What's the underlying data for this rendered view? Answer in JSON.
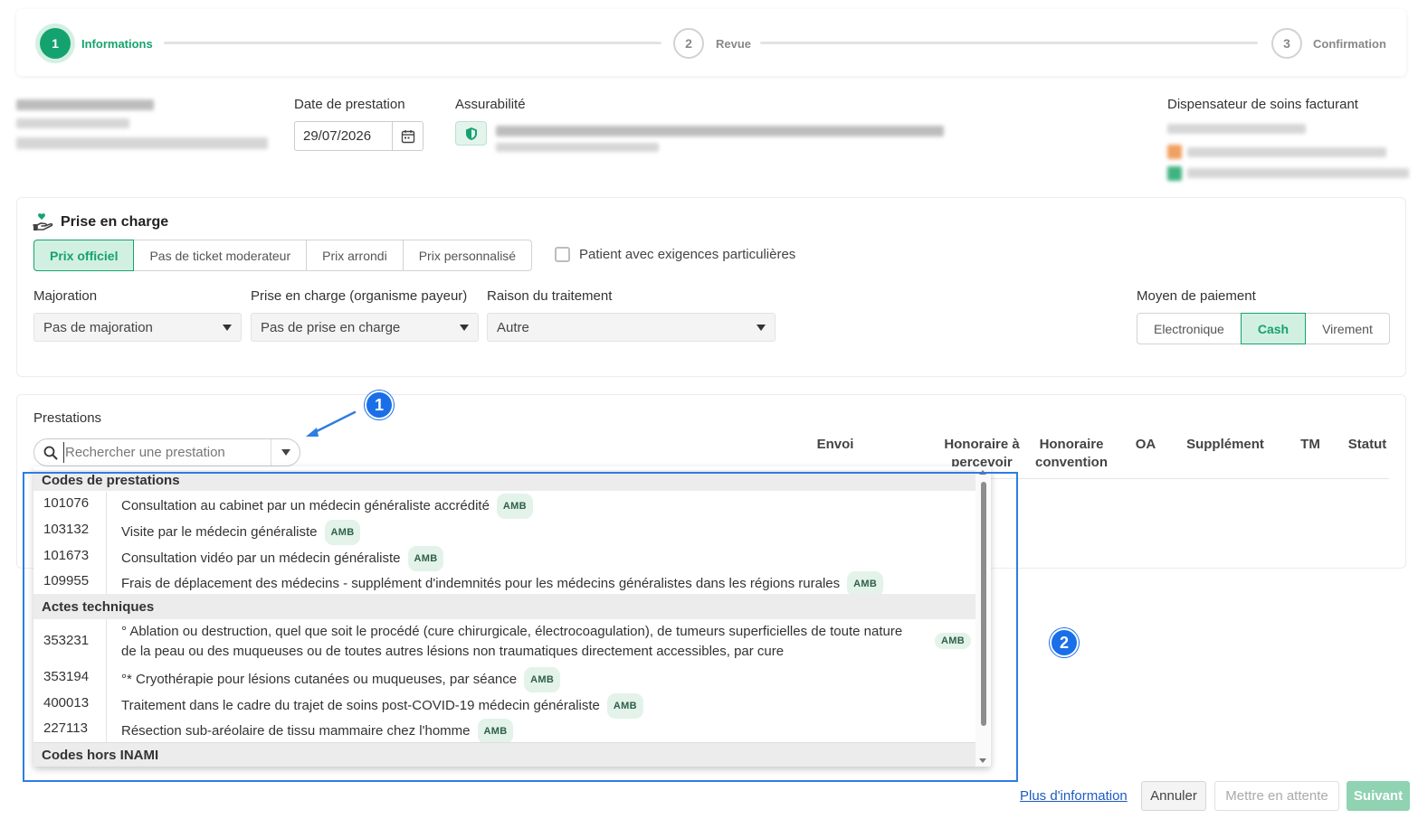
{
  "stepper": {
    "steps": [
      {
        "num": "1",
        "label": "Informations"
      },
      {
        "num": "2",
        "label": "Revue"
      },
      {
        "num": "3",
        "label": "Confirmation"
      }
    ]
  },
  "header": {
    "date_label": "Date de prestation",
    "date_value": "29/07/2026",
    "assurabilite_label": "Assurabilité",
    "dispensateur_label": "Dispensateur de soins facturant"
  },
  "prise": {
    "title": "Prise en charge",
    "price_options": [
      "Prix officiel",
      "Pas de ticket moderateur",
      "Prix arrondi",
      "Prix personnalisé"
    ],
    "special_checkbox": "Patient avec exigences particulières",
    "majoration_label": "Majoration",
    "majoration_value": "Pas de majoration",
    "organisme_label": "Prise en charge (organisme payeur)",
    "organisme_value": "Pas de prise en charge",
    "raison_label": "Raison du traitement",
    "raison_value": "Autre",
    "paiement_label": "Moyen de paiement",
    "paiement_options": [
      "Electronique",
      "Cash",
      "Virement"
    ]
  },
  "prestations": {
    "title": "Prestations",
    "search_placeholder": "Rechercher une prestation",
    "columns": [
      "Envoi",
      "Honoraire à percevoir",
      "Honoraire convention",
      "OA",
      "Supplément",
      "TM",
      "Statut"
    ],
    "groups": [
      {
        "title": "Codes de prestations",
        "items": [
          {
            "code": "101076",
            "desc": "Consultation au cabinet par un médecin généraliste accrédité",
            "badge": "AMB"
          },
          {
            "code": "103132",
            "desc": "Visite par le médecin généraliste",
            "badge": "AMB"
          },
          {
            "code": "101673",
            "desc": "Consultation vidéo par un médecin généraliste",
            "badge": "AMB"
          },
          {
            "code": "109955",
            "desc": "Frais de déplacement des médecins - supplément d'indemnités pour les médecins généralistes dans les régions rurales",
            "badge": "AMB"
          }
        ]
      },
      {
        "title": "Actes techniques",
        "items": [
          {
            "code": "353231",
            "desc1": "° Ablation ou destruction, quel que soit le procédé (cure chirurgicale, électrocoagulation), de tumeurs superficielles de toute nature",
            "desc2": "de la peau ou des muqueuses ou de toutes autres lésions non traumatiques directement accessibles, par cure",
            "badge": "AMB"
          },
          {
            "code": "353194",
            "desc": "°* Cryothérapie pour lésions cutanées ou muqueuses, par séance",
            "badge": "AMB"
          },
          {
            "code": "400013",
            "desc": "Traitement dans le cadre du trajet de soins post-COVID-19 médecin généraliste",
            "badge": "AMB"
          },
          {
            "code": "227113",
            "desc": "Résection sub-aréolaire de tissu mammaire chez l'homme",
            "badge": "AMB"
          }
        ]
      },
      {
        "title": "Codes hors INAMI",
        "items": []
      }
    ]
  },
  "annotations": {
    "one": "1",
    "two": "2"
  },
  "footer": {
    "more_info": "Plus d'information",
    "cancel": "Annuler",
    "hold": "Mettre en attente",
    "next": "Suivant"
  },
  "colors": {
    "accent": "#14a36f",
    "annotation": "#1a6fe8",
    "link": "#1d5bbf"
  }
}
